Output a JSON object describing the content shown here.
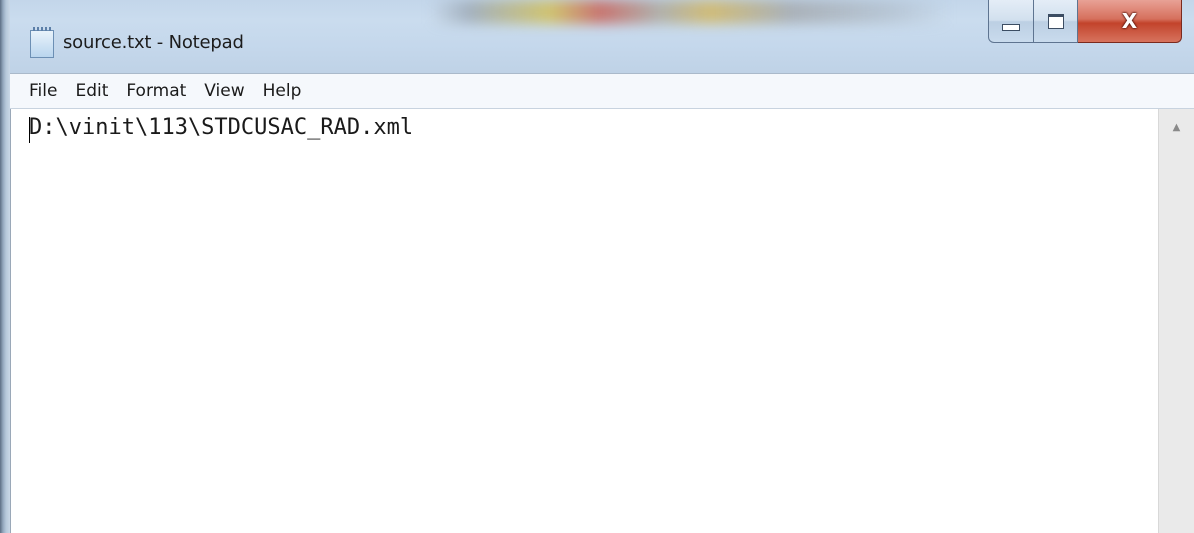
{
  "window": {
    "title": "source.txt - Notepad",
    "icon": "notepad-icon",
    "controls": {
      "minimize_icon": "minimize-icon",
      "maximize_icon": "maximize-icon",
      "close_label": "X"
    }
  },
  "menubar": {
    "items": [
      {
        "label": "File"
      },
      {
        "label": "Edit"
      },
      {
        "label": "Format"
      },
      {
        "label": "View"
      },
      {
        "label": "Help"
      }
    ]
  },
  "editor": {
    "content": "D:\\vinit\\113\\STDCUSAC_RAD.xml"
  },
  "scrollbar": {
    "up_arrow": "▲"
  },
  "colors": {
    "titlebar": "#c5d8ec",
    "close_button": "#c2432b",
    "menubar": "#f5f8fc"
  }
}
